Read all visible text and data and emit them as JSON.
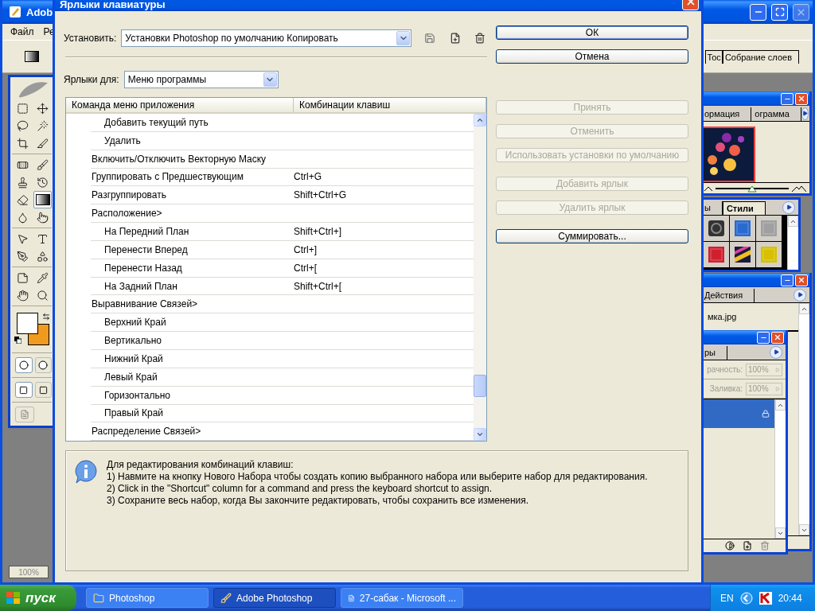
{
  "background_app": {
    "title": "Adob",
    "menu": [
      "Файл",
      "Ре"
    ],
    "tabs": [
      {
        "label": "Тос",
        "selected": false
      },
      {
        "label": "Собрание слоев",
        "selected": false
      }
    ],
    "zoom": "100%",
    "tools": [
      {
        "kind": "marquee",
        "selected": false
      },
      {
        "kind": "move",
        "selected": false
      },
      {
        "kind": "lasso",
        "selected": false
      },
      {
        "kind": "wand",
        "selected": false
      },
      {
        "kind": "crop",
        "selected": false
      },
      {
        "kind": "slice",
        "selected": false
      },
      {
        "kind": "heal",
        "selected": false
      },
      {
        "kind": "brush",
        "selected": false
      },
      {
        "kind": "stamp",
        "selected": false
      },
      {
        "kind": "history",
        "selected": false
      },
      {
        "kind": "eraser",
        "selected": false
      },
      {
        "kind": "gradient",
        "selected": true
      },
      {
        "kind": "blur",
        "selected": false
      },
      {
        "kind": "smudge",
        "selected": false
      },
      {
        "kind": "select",
        "selected": false
      },
      {
        "kind": "type",
        "selected": false
      },
      {
        "kind": "pen",
        "selected": false
      },
      {
        "kind": "shape",
        "selected": false
      },
      {
        "kind": "notes",
        "selected": false
      },
      {
        "kind": "eyedropper",
        "selected": false
      },
      {
        "kind": "hand",
        "selected": false
      },
      {
        "kind": "zoom",
        "selected": false
      }
    ]
  },
  "panels": {
    "navigator": {
      "tabs": [
        {
          "label": "ормация",
          "selected": false
        },
        {
          "label": "ограмма",
          "selected": false
        }
      ],
      "zoom_slider": {
        "level": 0.5
      }
    },
    "styles": {
      "tabs": [
        {
          "label": "ы",
          "selected": false
        },
        {
          "label": "Стили",
          "selected": true
        }
      ]
    },
    "history": {
      "tabs": [
        {
          "label": "Действия",
          "selected": false
        }
      ],
      "items": [
        "мка.jpg"
      ]
    },
    "layers": {
      "tabs": [
        {
          "label": "ры",
          "selected": false
        }
      ],
      "opacity_label": "рачность:",
      "opacity": "100%",
      "fill_label": "Заливка:",
      "fill": "100%",
      "layers": [
        {
          "selected": true,
          "locked": true
        }
      ]
    }
  },
  "dialog": {
    "title": "Ярлыки клавиатуры",
    "set": {
      "label": "Установить:",
      "value": "Установки Photoshop по умолчанию Копировать"
    },
    "shortcuts_for": {
      "label": "Ярлыки для:",
      "value": "Меню программы"
    },
    "table": {
      "columns": [
        "Команда меню приложения",
        "Комбинации клавиш"
      ],
      "rows": [
        {
          "children": [
            {
              "command": "Добавить текущий путь"
            },
            {
              "command": "Удалить"
            }
          ]
        },
        {
          "command": "Включить/Отключить Векторную Маску"
        },
        {
          "command": "Группировать с Предшествующим",
          "shortcut": "Ctrl+G"
        },
        {
          "command": "Разгруппировать",
          "shortcut": "Shift+Ctrl+G"
        },
        {
          "command": "Расположение>",
          "children": [
            {
              "command": "На Передний План",
              "shortcut": "Shift+Ctrl+]"
            },
            {
              "command": "Перенести Вперед",
              "shortcut": "Ctrl+]"
            },
            {
              "command": "Перенести Назад",
              "shortcut": "Ctrl+["
            },
            {
              "command": "На Задний План",
              "shortcut": "Shift+Ctrl+["
            }
          ]
        },
        {
          "command": "Выравнивание Связей>",
          "children": [
            {
              "command": "Верхний Край"
            },
            {
              "command": "Вертикально"
            },
            {
              "command": "Нижний Край"
            },
            {
              "command": "Левый Край"
            },
            {
              "command": "Горизонтально"
            },
            {
              "command": "Правый Край"
            }
          ]
        },
        {
          "command": "Распределение Связей>"
        }
      ]
    },
    "button_groups": [
      [
        {
          "label": "ОК",
          "disabled": false,
          "default": true
        },
        {
          "label": "Отмена",
          "disabled": false,
          "default": false
        }
      ],
      [
        {
          "label": "Принять",
          "disabled": true,
          "default": false
        },
        {
          "label": "Отменить",
          "disabled": true,
          "default": false
        },
        {
          "label": "Использовать установки по умолчанию",
          "disabled": true,
          "default": false
        }
      ],
      [
        {
          "label": "Добавить ярлык",
          "disabled": true,
          "default": false
        },
        {
          "label": "Удалить ярлык",
          "disabled": true,
          "default": false
        }
      ],
      [
        {
          "label": "Суммировать...",
          "disabled": false,
          "default": false
        }
      ]
    ],
    "info": {
      "heading": "Для редактирования комбинаций клавиш:",
      "steps": [
        "1) Навмите на кнопку Нового Набора чтобы создать копию выбранного набора или выберите набор для редактирования.",
        "2) Click in the \"Shortcut\" column for a command and press the keyboard shortcut to assign.",
        "3) Сохраните весь набор, когда Вы закончите редактировать, чтобы сохранить все изменения."
      ]
    }
  },
  "taskbar": {
    "start": "пуск",
    "tasks": [
      {
        "label": "Photoshop",
        "kind": "folder",
        "selected": false
      },
      {
        "label": "Adobe Photoshop",
        "kind": "app",
        "selected": true
      },
      {
        "label": "27-сабак - Microsoft ...",
        "kind": "document",
        "selected": false
      }
    ],
    "language": "EN",
    "clock": "20:44"
  }
}
